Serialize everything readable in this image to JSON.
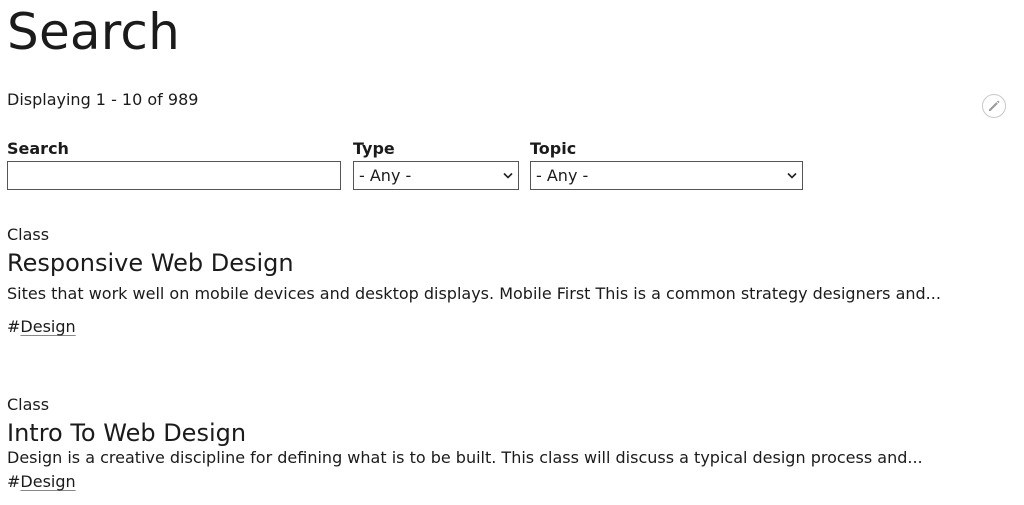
{
  "page": {
    "title": "Search",
    "summary": "Displaying 1 - 10 of 989"
  },
  "toolbar": {
    "edit_icon": "pencil-icon"
  },
  "filters": {
    "search": {
      "label": "Search",
      "value": "",
      "placeholder": ""
    },
    "type": {
      "label": "Type",
      "selected": "- Any -"
    },
    "topic": {
      "label": "Topic",
      "selected": "- Any -"
    }
  },
  "results": [
    {
      "type": "Class",
      "title": "Responsive Web Design",
      "snippet": "Sites that work well on mobile devices and desktop displays. Mobile First This is a common strategy designers and...",
      "tag_prefix": "#",
      "tag": "Design"
    },
    {
      "type": "Class",
      "title": "Intro To Web Design",
      "snippet": "Design is a creative discipline for defining what is to be built. This class will discuss a typical design process and...",
      "tag_prefix": "#",
      "tag": "Design"
    }
  ]
}
